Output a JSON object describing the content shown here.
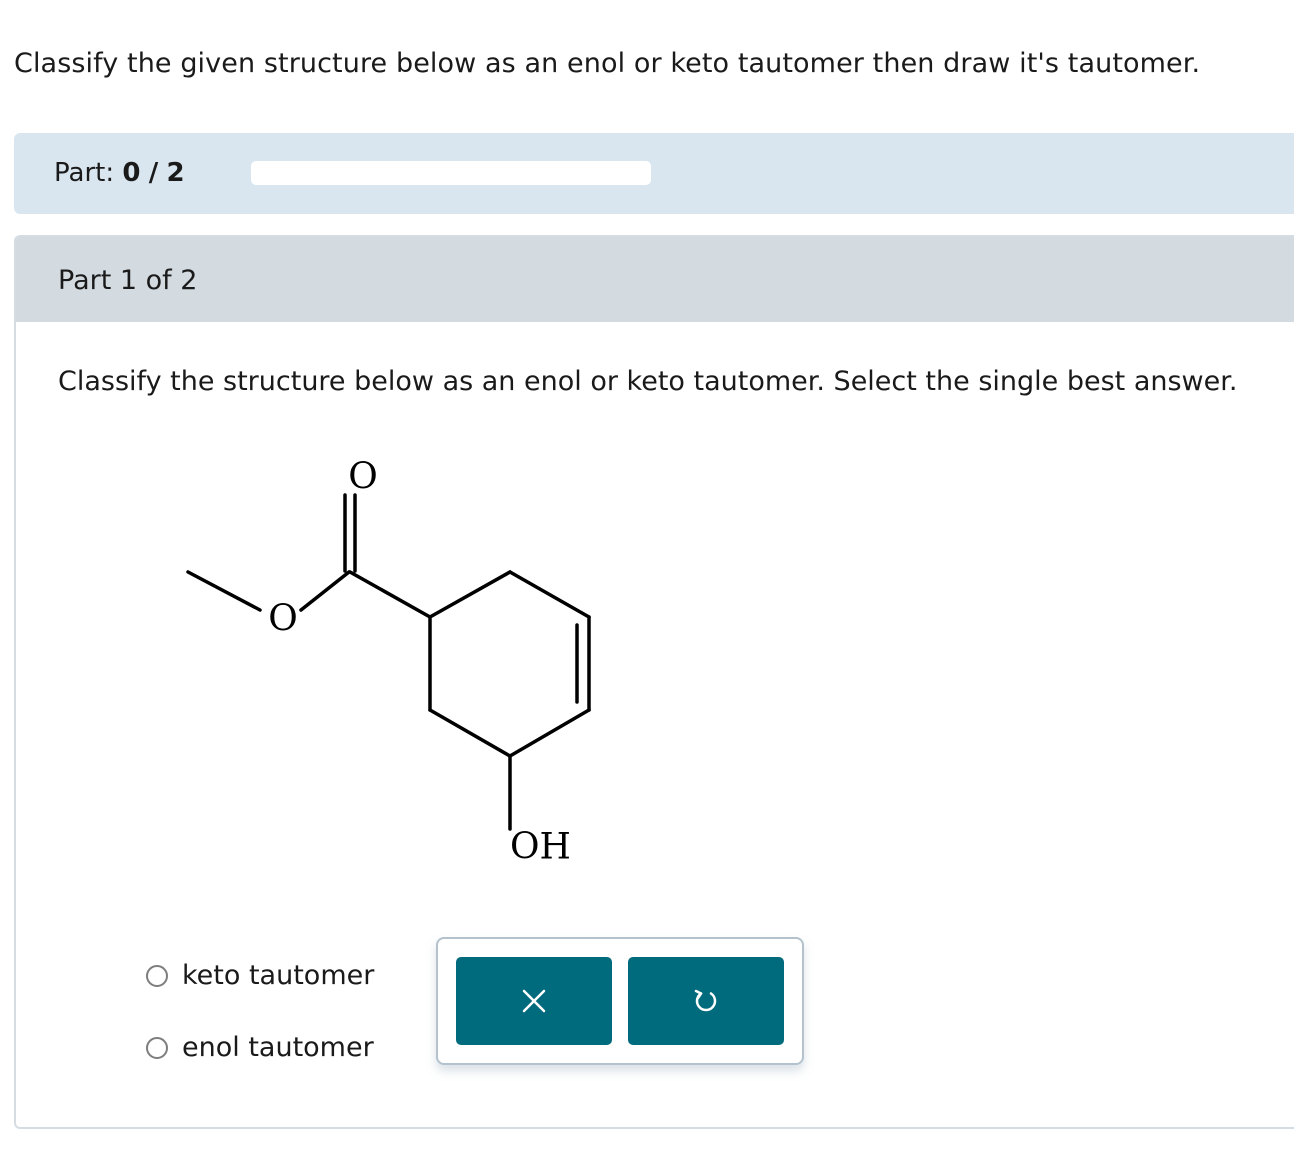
{
  "question": {
    "text": "Classify the given structure below as an enol or keto tautomer then draw it's tautomer."
  },
  "progress": {
    "label": "Part:",
    "current": "0",
    "separator": "/",
    "total": "2",
    "fraction_complete": 0
  },
  "part": {
    "title": "Part 1 of 2",
    "instruction": "Classify the structure below as an enol or keto tautomer. Select the single best answer."
  },
  "molecule": {
    "labels": {
      "carbonyl_oxygen": "O",
      "ester_oxygen": "O",
      "hydroxyl": "OH"
    }
  },
  "options": [
    {
      "label": "keto tautomer",
      "selected": false
    },
    {
      "label": "enol tautomer",
      "selected": false
    }
  ],
  "buttons": {
    "clear_icon": "close-icon",
    "undo_icon": "undo-icon"
  },
  "colors": {
    "accent": "#006b7c",
    "progress_panel": "#dae6ef",
    "part_header": "#d3dbe1"
  }
}
